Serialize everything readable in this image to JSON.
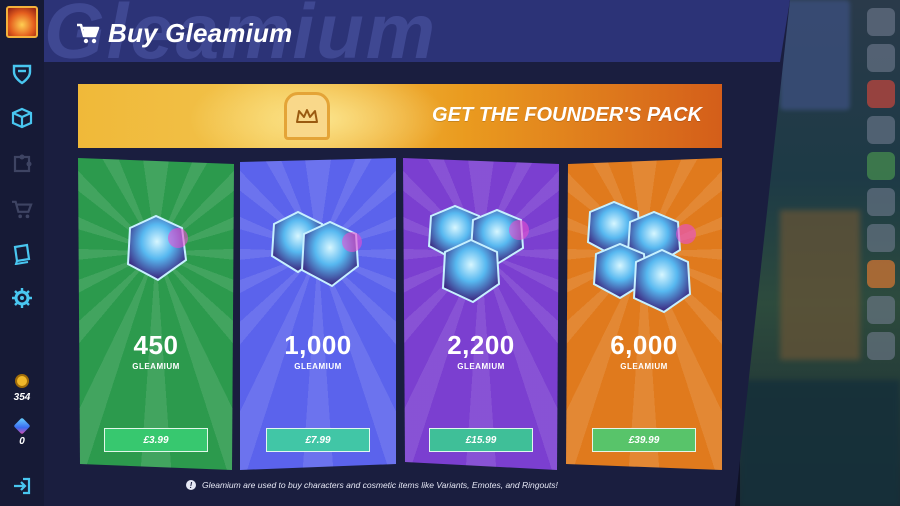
{
  "header": {
    "title": "Buy Gleamium",
    "watermark": "Gleamium"
  },
  "sidebar": {
    "coins": "354",
    "gems": "0",
    "items": [
      {
        "icon": "shield-icon"
      },
      {
        "icon": "box-icon"
      },
      {
        "icon": "puzzle-icon"
      },
      {
        "icon": "cart-icon"
      },
      {
        "icon": "book-icon"
      },
      {
        "icon": "gear-icon"
      },
      {
        "icon": "exit-icon"
      }
    ]
  },
  "founder_banner": {
    "label": "GET THE FOUNDER'S PACK",
    "icon": "toast-crown-icon"
  },
  "offers": [
    {
      "amount": "450",
      "currency_label": "GLEAMIUM",
      "price": "£3.99",
      "color": "#2c9a4d"
    },
    {
      "amount": "1,000",
      "currency_label": "GLEAMIUM",
      "price": "£7.99",
      "color": "#5b63ec"
    },
    {
      "amount": "2,200",
      "currency_label": "GLEAMIUM",
      "price": "£15.99",
      "color": "#7b3fd0"
    },
    {
      "amount": "6,000",
      "currency_label": "GLEAMIUM",
      "price": "£39.99",
      "color": "#e07a1d"
    }
  ],
  "footnote": "Gleamium are used to buy characters and cosmetic items like Variants, Emotes, and Ringouts!"
}
